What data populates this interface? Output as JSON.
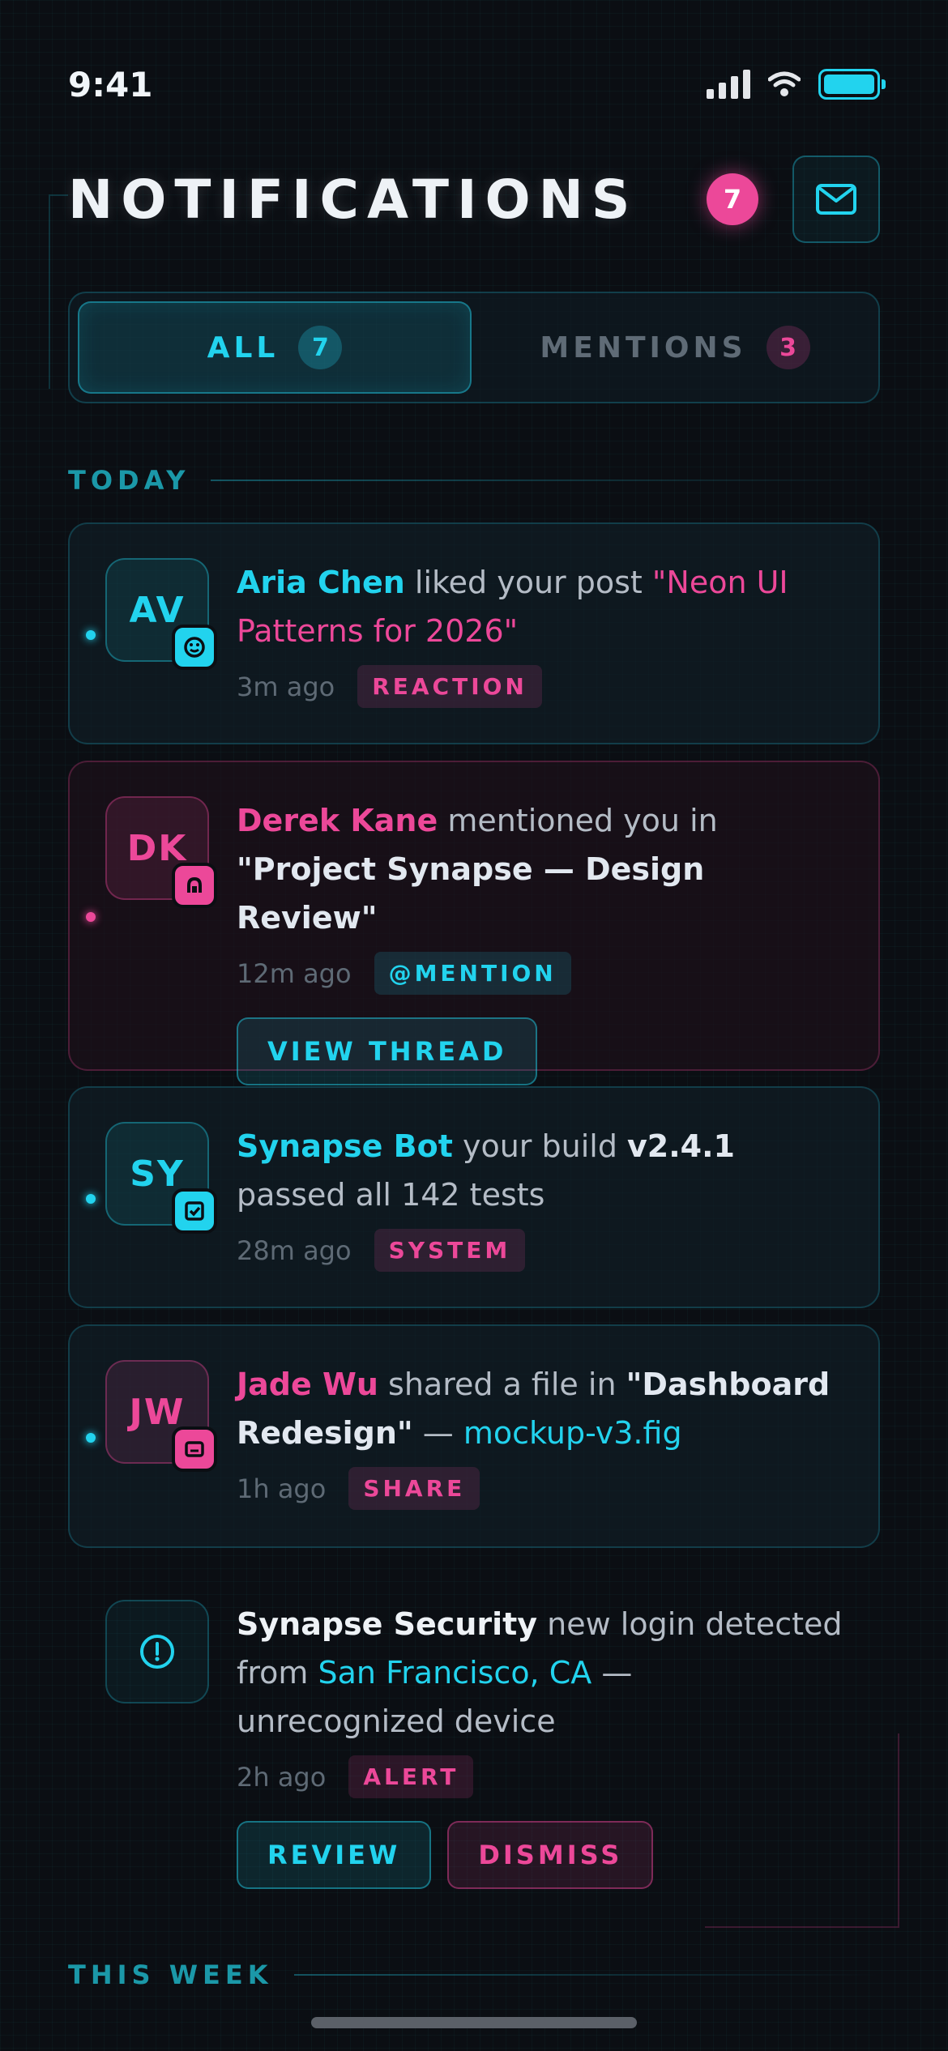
{
  "status_bar": {
    "time": "9:41"
  },
  "header": {
    "title": "NOTIFICATIONS",
    "count": "7"
  },
  "tabs": [
    {
      "label": "ALL",
      "count": "7"
    },
    {
      "label": "MENTIONS",
      "count": "3"
    }
  ],
  "sections": {
    "today": "TODAY",
    "this_week": "THIS WEEK"
  },
  "notifications": [
    {
      "initials": "AV",
      "name": "Aria Chen",
      "text": " liked your post ",
      "highlight": "\"Neon UI Patterns for 2026\"",
      "time": "3m ago",
      "tag": "REACTION"
    },
    {
      "initials": "DK",
      "name": "Derek Kane",
      "text": " mentioned you in ",
      "highlight": "\"Project Synapse — Design Review\"",
      "time": "12m ago",
      "tag": "@MENTION",
      "action": "VIEW THREAD"
    },
    {
      "initials": "SY",
      "name": "Synapse Bot",
      "text": " your build ",
      "highlight": "v2.4.1",
      "text2": " passed all 142 tests",
      "time": "28m ago",
      "tag": "SYSTEM"
    },
    {
      "initials": "JW",
      "name": "Jade Wu",
      "text": " shared a file in ",
      "highlight": "\"Dashboard Redesign\"",
      "text2": " — ",
      "link": "mockup-v3.fig",
      "time": "1h ago",
      "tag": "SHARE"
    },
    {
      "name": "Synapse Security",
      "text": " new login detected from ",
      "link": "San Francisco, CA",
      "text2": " — unrecognized device",
      "time": "2h ago",
      "tag": "ALERT",
      "action_primary": "REVIEW",
      "action_secondary": "DISMISS"
    }
  ],
  "colors": {
    "cyan": "#22d3ee",
    "pink": "#ec4899",
    "background": "#0b0e13"
  }
}
